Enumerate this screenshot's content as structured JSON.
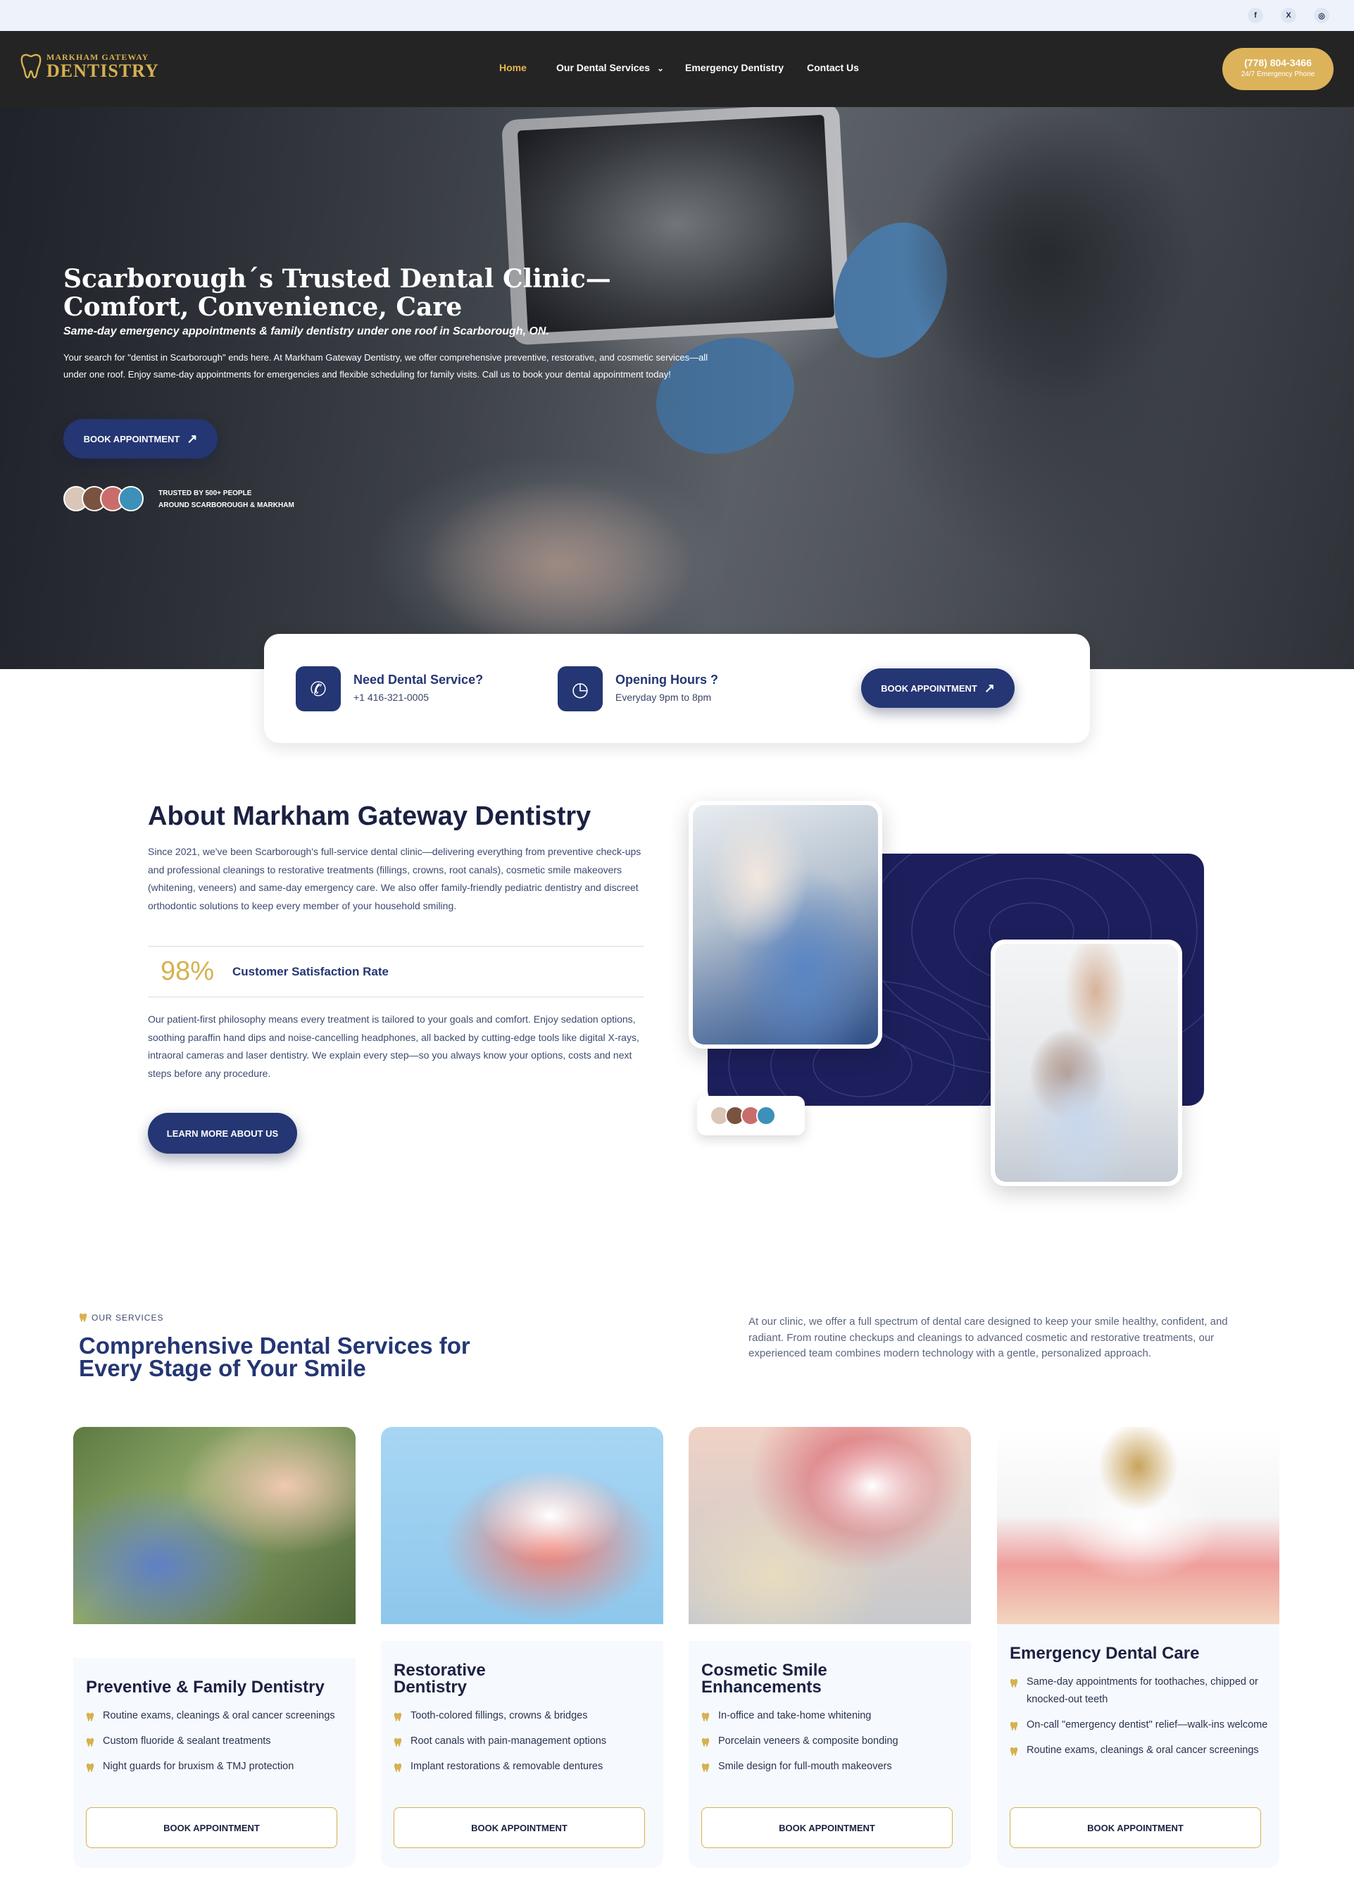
{
  "topbar": {
    "social": [
      {
        "icon": "facebook-icon",
        "glyph": "f"
      },
      {
        "icon": "x-twitter-icon",
        "glyph": "X"
      },
      {
        "icon": "instagram-icon",
        "glyph": "◎"
      }
    ]
  },
  "header": {
    "logo_small": "MARKHAM GATEWAY",
    "logo_big": "DENTISTRY",
    "nav": [
      {
        "label": "Home",
        "active": true
      },
      {
        "label": "Our Dental Services",
        "dropdown": true
      },
      {
        "label": "Emergency Dentistry"
      },
      {
        "label": "Contact Us"
      }
    ],
    "dropdown_glyph": "⌄",
    "phone": "(778) 804-3466",
    "phone_sub": "24/7 Emergency Phone"
  },
  "hero": {
    "title": "Scarborough´s Trusted Dental Clinic—Comfort, Convenience, Care",
    "subtitle": "Same-day emergency appointments & family dentistry under one roof in Scarborough, ON.",
    "description": "Your search for \"dentist in Scarborough\" ends here. At Markham Gateway Dentistry, we offer comprehensive preventive, restorative, and cosmetic services—all under one roof. Enjoy same-day appointments for emergencies and flexible scheduling for family visits. Call us to book your dental appointment today!",
    "cta": "BOOK APPOINTMENT",
    "cta_arrow": "↗",
    "trusted_line1": "TRUSTED BY 500+ PEOPLE",
    "trusted_line2": "AROUND SCARBOROUGH & MARKHAM"
  },
  "info_card": {
    "service_title": "Need Dental Service?",
    "service_phone": "+1 416-321-0005",
    "hours_title": "Opening Hours ?",
    "hours_text": "Everyday 9pm to 8pm",
    "cta": "BOOK APPOINTMENT",
    "cta_arrow": "↗"
  },
  "about": {
    "title": "About Markham Gateway Dentistry",
    "p1": "Since 2021, we've been Scarborough's full-service dental clinic—delivering everything from preventive check-ups and professional cleanings to restorative treatments (fillings, crowns, root canals), cosmetic smile makeovers (whitening, veneers) and same-day emergency care. We also offer family-friendly pediatric dentistry and discreet orthodontic solutions to keep every member of your household smiling.",
    "stat_value": "98%",
    "stat_label": "Customer Satisfaction Rate",
    "p2": "Our patient-first philosophy means every treatment is tailored to your goals and comfort. Enjoy sedation options, soothing paraffin hand dips and noise-cancelling headphones, all backed by cutting-edge tools like digital X-rays, intraoral cameras and laser dentistry. We explain every step—so you always know your options, costs and next steps before any procedure.",
    "cta": "LEARN MORE ABOUT US"
  },
  "services": {
    "eyebrow": "OUR SERVICES",
    "title": "Comprehensive Dental Services for Every Stage of Your Smile",
    "description": "At our clinic, we offer a full spectrum of dental care designed to keep your smile healthy, confident, and radiant. From routine checkups and cleanings to advanced cosmetic and restorative treatments, our experienced team combines modern technology with a gentle, personalized approach.",
    "cards": [
      {
        "title": "Preventive & Family Dentistry",
        "items": [
          "Routine exams, cleanings & oral cancer screenings",
          "Custom fluoride & sealant treatments",
          "Night guards for bruxism & TMJ protection"
        ],
        "button": "BOOK APPOINTMENT"
      },
      {
        "title": "Restorative Dentistry",
        "items": [
          "Tooth-colored fillings, crowns & bridges",
          "Root canals with pain-management options",
          "Implant restorations & removable dentures"
        ],
        "button": "BOOK APPOINTMENT"
      },
      {
        "title": "Cosmetic Smile Enhancements",
        "items": [
          "In-office and take-home whitening",
          "Porcelain veneers & composite bonding",
          "Smile design for full-mouth makeovers"
        ],
        "button": "BOOK APPOINTMENT"
      },
      {
        "title": "Emergency Dental Care",
        "items": [
          "Same-day appointments for toothaches, chipped or knocked-out teeth",
          "On-call \"emergency dentist\" relief—walk-ins welcome",
          "Routine exams, cleanings & oral cancer screenings"
        ],
        "button": "BOOK APPOINTMENT"
      }
    ]
  },
  "colors": {
    "navy": "#243673",
    "gold": "#d6b14f",
    "header_bg": "#242424",
    "card_bg": "#f6f9fd"
  }
}
